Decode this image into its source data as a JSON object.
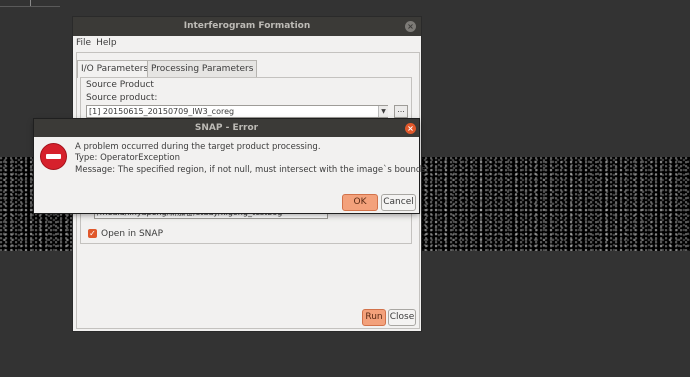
{
  "main_window": {
    "title": "Interferogram Formation",
    "menu": [
      "File",
      "Help"
    ],
    "tabs": [
      "I/O Parameters",
      "Processing Parameters"
    ],
    "source_group_label": "Source Product",
    "source_label": "Source product:",
    "source_value": "[1] 20150615_20150709_IW3_coreg",
    "browse_label": "...",
    "target_path": "/media/linyapeng/新加卷/study/xigong_testbog",
    "open_in_snap_label": "Open in SNAP",
    "run_label": "Run",
    "close_label": "Close"
  },
  "error_dialog": {
    "title": "SNAP - Error",
    "lines": [
      "A problem occurred during the target product processing.",
      "Type: OperatorException",
      "Message: The specified region, if not null, must intersect with the image`s bounds."
    ],
    "ok_label": "OK",
    "cancel_label": "Cancel"
  },
  "colors": {
    "accent": "#e0582b",
    "titlebar": "#3b3a37",
    "error_icon": "#d6212c"
  }
}
